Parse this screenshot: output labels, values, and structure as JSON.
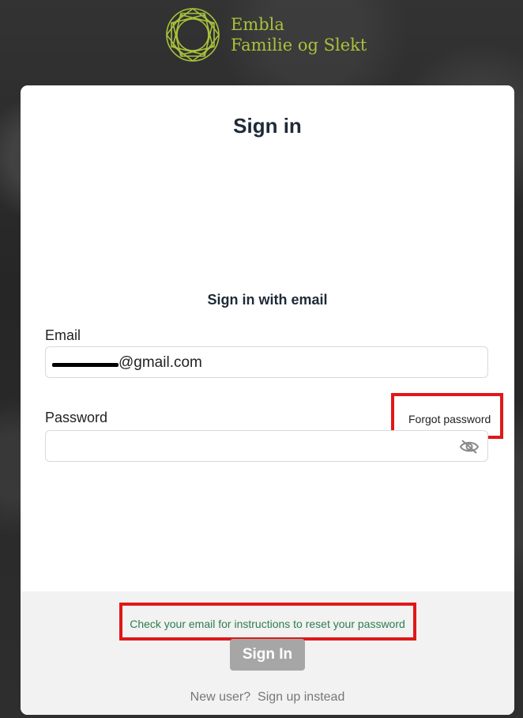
{
  "brand": {
    "line1": "Embla",
    "line2": "Familie og Slekt",
    "logo_icon": "geometric-circle-logo",
    "color": "#a8c23c"
  },
  "title": "Sign in",
  "subtitle": "Sign in with email",
  "email": {
    "label": "Email",
    "value": "@gmail.com"
  },
  "password": {
    "label": "Password",
    "value": "",
    "toggle_icon": "eye-slash-icon"
  },
  "forgot_password": "Forgot password",
  "reset_message": "Check your email for instructions to reset your password",
  "sign_in_button": "Sign In",
  "new_user": "New user?",
  "sign_up": "Sign up instead",
  "colors": {
    "highlight": "#e01818",
    "message": "#2e7d4f",
    "button_disabled": "#a6a6a6"
  }
}
